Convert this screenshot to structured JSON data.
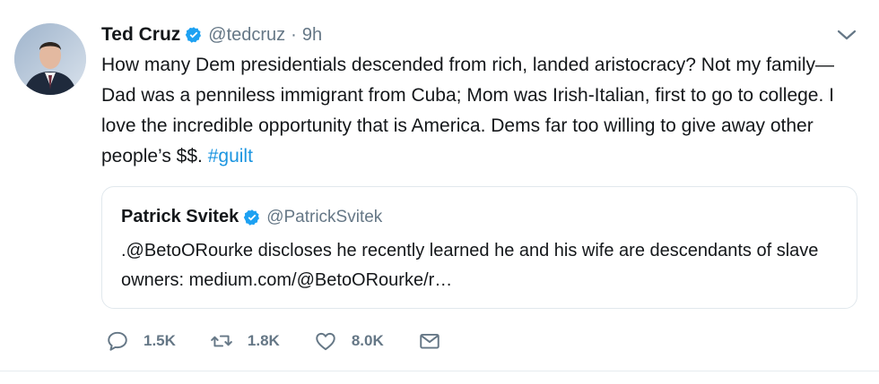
{
  "tweet": {
    "author_name": "Ted Cruz",
    "author_handle": "@tedcruz",
    "separator": "·",
    "time": "9h",
    "text_main": "How many Dem presidentials descended from rich, landed aristocracy? Not my family—Dad was a penniless immigrant from Cuba; Mom was Irish-Italian, first to go to college. I love the incredible opportunity that is America. Dems far too willing to give away other people’s $$.",
    "hashtag": "#guilt",
    "verified": true
  },
  "quoted_tweet": {
    "author_name": "Patrick Svitek",
    "author_handle": "@PatrickSvitek",
    "text": ".@BetoORourke discloses he recently learned he and his wife are descendants of slave owners: medium.com/@BetoORourke/r…",
    "verified": true
  },
  "actions": {
    "replies": "1.5K",
    "retweets": "1.8K",
    "likes": "8.0K"
  },
  "icons": {
    "verified": "verified-badge-icon",
    "caret": "chevron-down-icon",
    "reply": "reply-icon",
    "retweet": "retweet-icon",
    "like": "heart-icon",
    "message": "envelope-icon"
  },
  "colors": {
    "accent": "#1da1f2",
    "hashtag": "#1b95e0",
    "muted": "#657786",
    "border": "#e1e8ed"
  }
}
